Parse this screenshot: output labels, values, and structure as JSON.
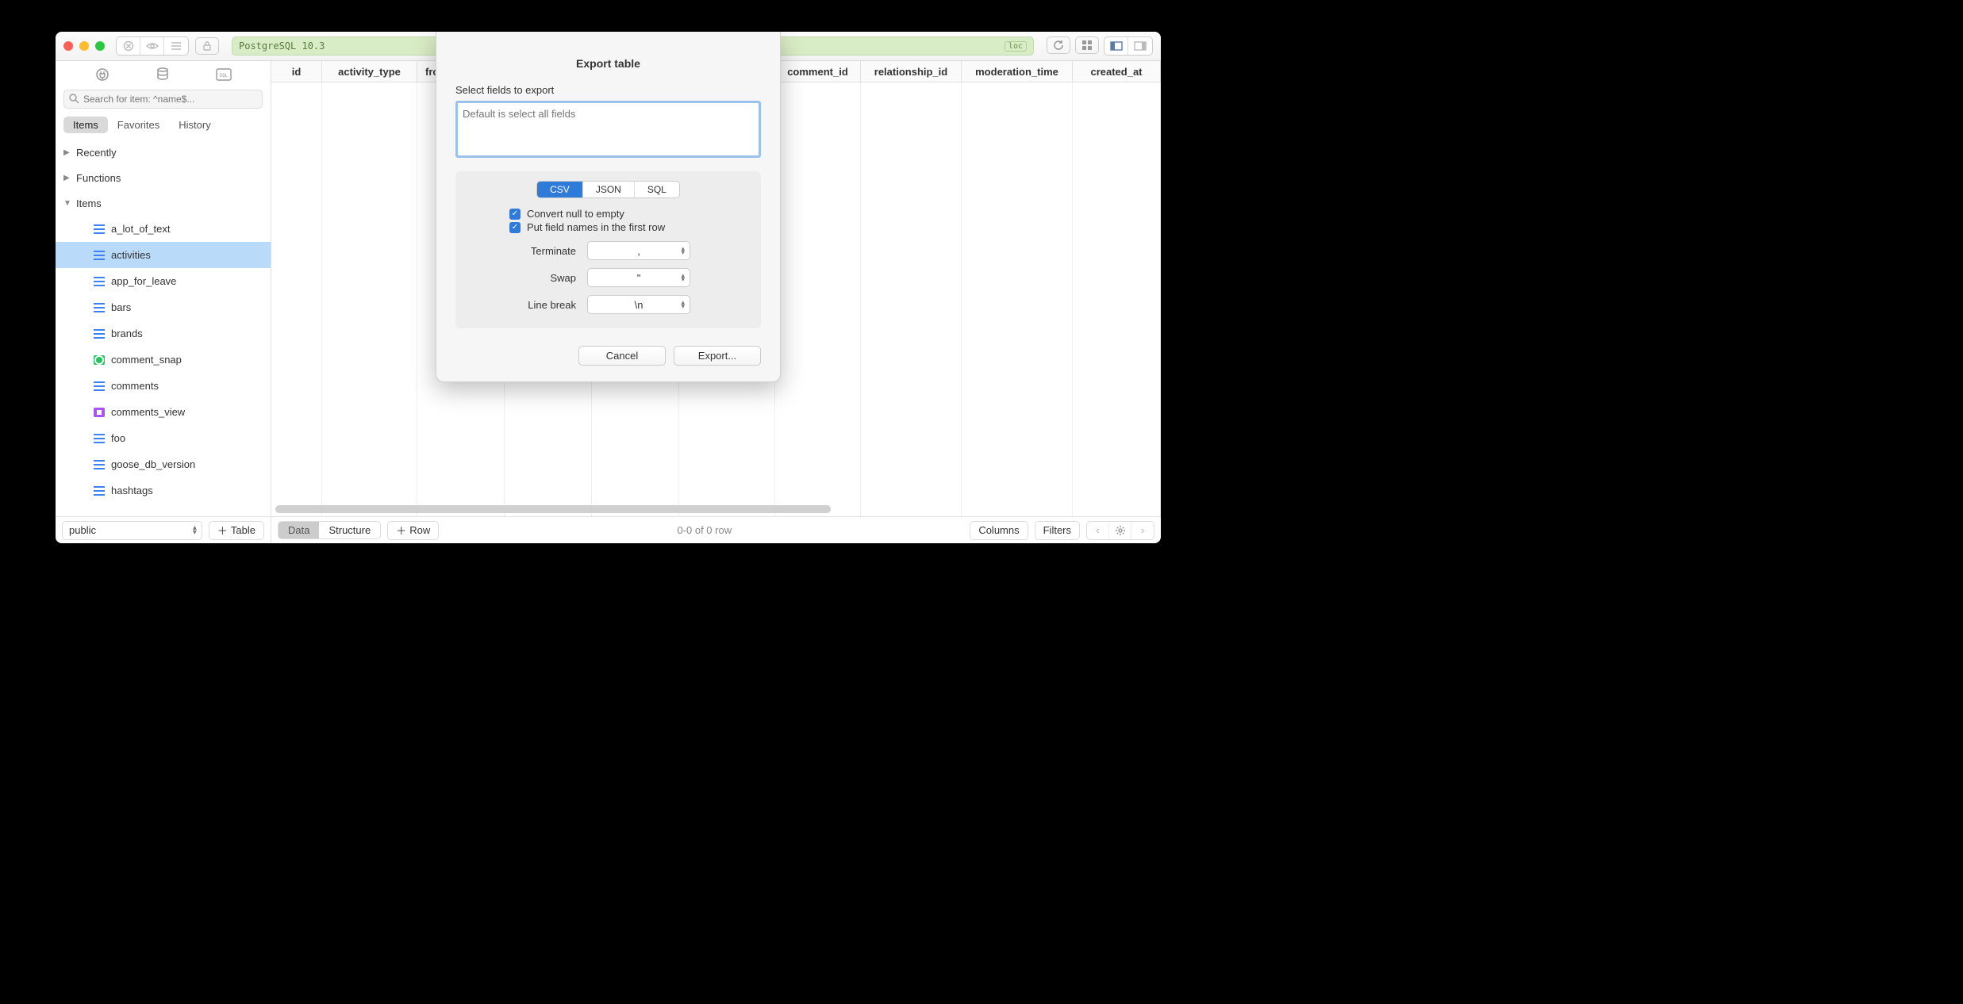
{
  "titlebar": {
    "connection": "PostgreSQL 10.3",
    "loc_badge": "loc"
  },
  "sidebar": {
    "search_placeholder": "Search for item: ^name$...",
    "tabs": {
      "items": "Items",
      "favorites": "Favorites",
      "history": "History"
    },
    "groups": {
      "recently": "Recently",
      "functions": "Functions",
      "items": "Items"
    },
    "tables": [
      {
        "name": "a_lot_of_text",
        "kind": "table"
      },
      {
        "name": "activities",
        "kind": "table",
        "selected": true
      },
      {
        "name": "app_for_leave",
        "kind": "table"
      },
      {
        "name": "bars",
        "kind": "table"
      },
      {
        "name": "brands",
        "kind": "table"
      },
      {
        "name": "comment_snap",
        "kind": "view_green"
      },
      {
        "name": "comments",
        "kind": "table"
      },
      {
        "name": "comments_view",
        "kind": "view_purple"
      },
      {
        "name": "foo",
        "kind": "table"
      },
      {
        "name": "goose_db_version",
        "kind": "table"
      },
      {
        "name": "hashtags",
        "kind": "table"
      }
    ],
    "schema": "public",
    "add_table": "Table"
  },
  "columns": [
    "id",
    "activity_type",
    "fro",
    "comment_id",
    "relationship_id",
    "moderation_time",
    "created_at"
  ],
  "bottom": {
    "data": "Data",
    "structure": "Structure",
    "row": "Row",
    "rowcount": "0-0 of 0 row",
    "columns": "Columns",
    "filters": "Filters"
  },
  "modal": {
    "title": "Export table",
    "select_label": "Select fields to export",
    "placeholder": "Default is select all fields",
    "formats": {
      "csv": "CSV",
      "json": "JSON",
      "sql": "SQL"
    },
    "opt_null": "Convert null to empty",
    "opt_header": "Put field names in the first row",
    "terminate_label": "Terminate",
    "terminate_val": ",",
    "swap_label": "Swap",
    "swap_val": "\"",
    "linebreak_label": "Line break",
    "linebreak_val": "\\n",
    "cancel": "Cancel",
    "export": "Export..."
  }
}
